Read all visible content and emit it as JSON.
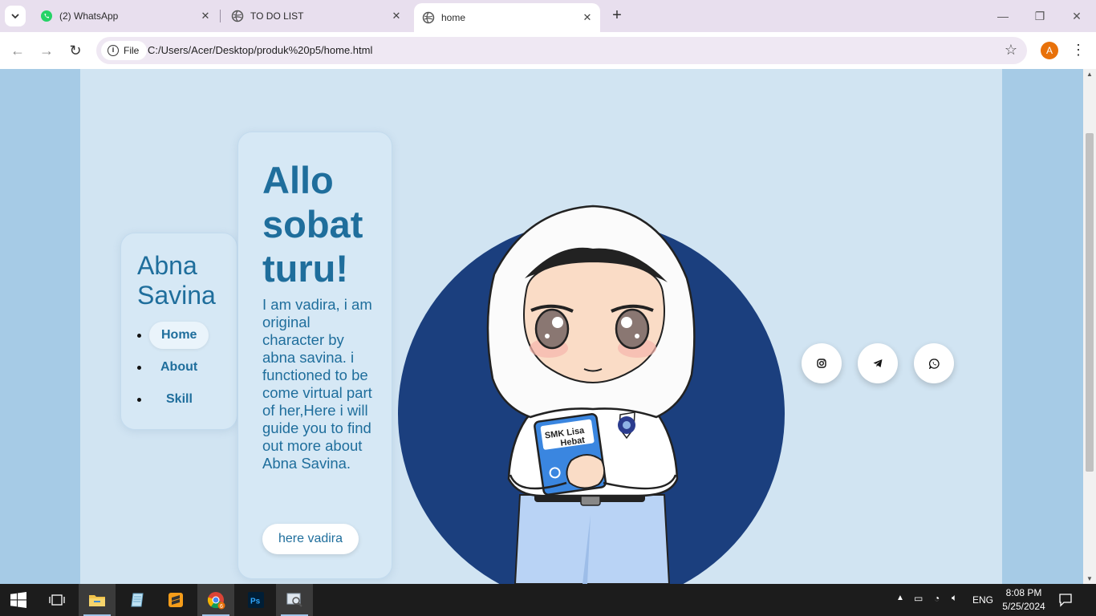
{
  "browser": {
    "tabs": [
      {
        "title": "(2) WhatsApp",
        "icon": "whatsapp-icon"
      },
      {
        "title": "TO DO LIST",
        "icon": "globe-icon"
      },
      {
        "title": "home",
        "icon": "globe-icon",
        "active": true
      }
    ],
    "address": {
      "scheme_label": "File",
      "url": "C:/Users/Acer/Desktop/produk%20p5/home.html"
    },
    "profile_initial": "A",
    "accent": "#e8710a"
  },
  "sidebar": {
    "name": "Abna Savina",
    "nav": [
      {
        "label": "Home",
        "active": true
      },
      {
        "label": "About",
        "active": false
      },
      {
        "label": "Skill",
        "active": false
      }
    ]
  },
  "hero": {
    "title": "Allo sobat turu!",
    "description": "I am vadira, i am original character by abna savina. i functioned to be come virtual part of her,Here i will guide you to find out more about Abna Savina.",
    "button_label": "here vadira"
  },
  "illustration": {
    "book_line1": "SMK Lisa",
    "book_line2": "Hebat"
  },
  "social": [
    "instagram-icon",
    "telegram-icon",
    "whatsapp-icon"
  ],
  "colors": {
    "primary_text": "#1f6e9c",
    "page_bg": "#d1e4f2",
    "outer_bg": "#a6cbe6",
    "circle": "#1b3f7e"
  },
  "taskbar": {
    "language": "ENG",
    "time": "8:08 PM",
    "date": "5/25/2024",
    "chrome_badge": "6"
  }
}
